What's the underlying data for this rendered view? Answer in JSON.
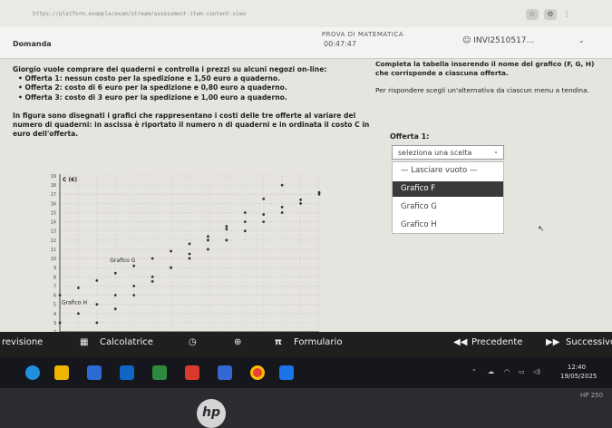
{
  "browser": {
    "url": "https://platform.example/exam/stream/assessment-item-content-view",
    "star_icon": "star-icon",
    "ext_icon": "extension-icon",
    "menu_icon": "kebab-menu-icon"
  },
  "header": {
    "exam_title": "PROVA DI MATEMATICA",
    "timer": "00:47:47",
    "user_id": "INVI2510517…"
  },
  "question": {
    "label": "Domanda",
    "intro": "Giorgio vuole comprare dei quaderni e controlla i prezzi su alcuni negozi on-line:",
    "offers": [
      "• Offerta 1: nessun costo per la spedizione e 1,50 euro a quaderno.",
      "• Offerta 2: costo di 6 euro per la spedizione e 0,80 euro a quaderno.",
      "• Offerta 3: costo di 3 euro per la spedizione e 1,00 euro a quaderno."
    ],
    "figure_text": "In figura sono disegnati i grafici che rappresentano i costi delle tre offerte al variare del numero di quaderni: in ascissa è riportato il numero n di quaderni e in ordinata il costo C in euro dell'offerta."
  },
  "instructions": {
    "line1": "Completa la tabella inserendo il nome del grafico (F, G, H) che corrisponde a ciascuna offerta.",
    "line2": "Per rispondere scegli un'alternativa da ciascun menu a tendina."
  },
  "answer": {
    "offer_label": "Offerta 1:",
    "select_placeholder": "seleziona una scelta",
    "options": [
      "— Lasciare vuoto —",
      "Grafico F",
      "Grafico G",
      "Grafico H"
    ],
    "highlighted_option": "Grafico F"
  },
  "chart_data": {
    "type": "scatter",
    "ylabel": "C (€)",
    "ylim": [
      2,
      19
    ],
    "y_ticks": [
      2,
      3,
      4,
      5,
      6,
      7,
      8,
      9,
      10,
      11,
      12,
      13,
      14,
      15,
      16,
      17,
      18,
      19
    ],
    "grid": true,
    "labels": [
      "Grafico G",
      "Grafico H"
    ],
    "series": [
      {
        "name": "Grafico F",
        "color": "#333333",
        "x": [
          0,
          1,
          2,
          3,
          4,
          5,
          6,
          7,
          8,
          9,
          10,
          11,
          12,
          13,
          14
        ],
        "y": [
          6,
          6.8,
          7.6,
          8.4,
          9.2,
          10,
          10.8,
          11.6,
          12.4,
          13.2,
          14,
          14.8,
          15.6,
          16.4,
          17.2
        ]
      },
      {
        "name": "Grafico G",
        "color": "#333333",
        "x": [
          0,
          1,
          2,
          3,
          4,
          5,
          6,
          7,
          8,
          9,
          10,
          11,
          12,
          13,
          14
        ],
        "y": [
          3,
          4,
          5,
          6,
          7,
          8,
          9,
          10,
          11,
          12,
          13,
          14,
          15,
          16,
          17
        ]
      },
      {
        "name": "Grafico H",
        "color": "#333333",
        "x": [
          0,
          1,
          2,
          3,
          4,
          5,
          6,
          7,
          8,
          9,
          10,
          11,
          12
        ],
        "y": [
          0,
          1.5,
          3,
          4.5,
          6,
          7.5,
          9,
          10.5,
          12,
          13.5,
          15,
          16.5,
          18
        ]
      }
    ]
  },
  "toolbar": {
    "revisione": "revisione",
    "calcolatrice": "Calcolatrice",
    "formulario": "Formulario",
    "precedente": "Precedente",
    "successivo": "Successivo"
  },
  "taskbar": {
    "time": "12:40",
    "date": "19/05/2025"
  },
  "device": {
    "model": "HP 250",
    "logo": "hp"
  }
}
